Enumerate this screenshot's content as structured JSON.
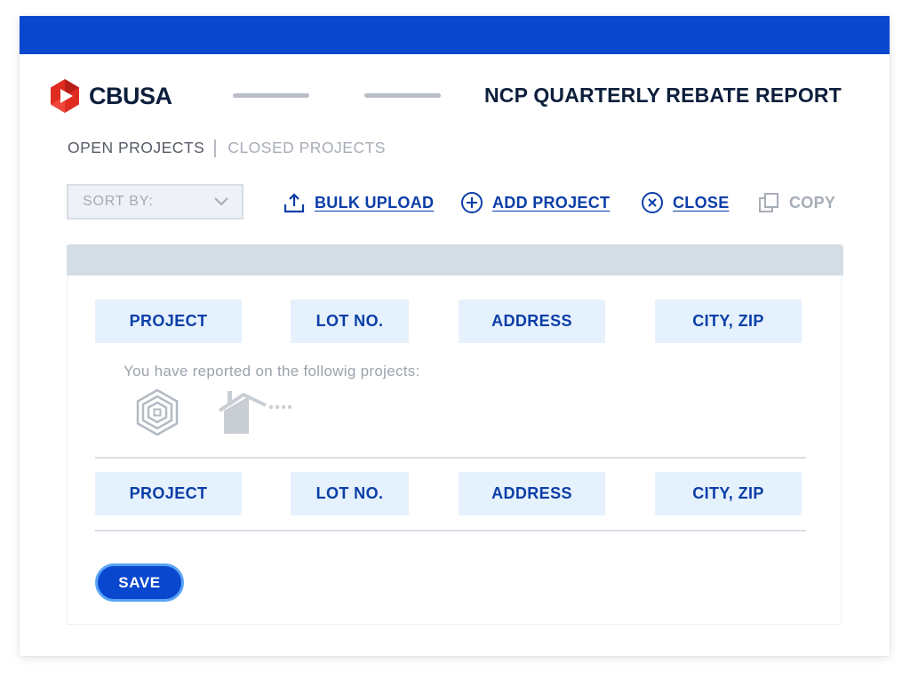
{
  "brand": {
    "name": "CBUSA"
  },
  "header": {
    "title": "NCP QUARTERLY REBATE REPORT"
  },
  "tabs": [
    {
      "label": "OPEN PROJECTS",
      "active": true
    },
    {
      "label": "CLOSED PROJECTS",
      "active": false
    }
  ],
  "toolbar": {
    "sort": {
      "label": "SORT BY:"
    },
    "actions": [
      {
        "label": "BULK UPLOAD",
        "icon": "upload-icon",
        "enabled": true
      },
      {
        "label": "ADD PROJECT",
        "icon": "plus-circle-icon",
        "enabled": true
      },
      {
        "label": "CLOSE",
        "icon": "x-circle-icon",
        "enabled": true
      },
      {
        "label": "COPY",
        "icon": "copy-icon",
        "enabled": false
      }
    ]
  },
  "table": {
    "columns": [
      "PROJECT",
      "LOT NO.",
      "ADDRESS",
      "CITY, ZIP"
    ],
    "columns_repeat": [
      "PROJECT",
      "LOT NO.",
      "ADDRESS",
      "CITY, ZIP"
    ],
    "info": "You have reported on the followig projects:"
  },
  "footer": {
    "save_label": "SAVE"
  },
  "colors": {
    "primary": "#0a47cf",
    "link": "#0a3ea8",
    "header_cell_bg": "#e5f1fc",
    "logo_red": "#e02b20"
  }
}
